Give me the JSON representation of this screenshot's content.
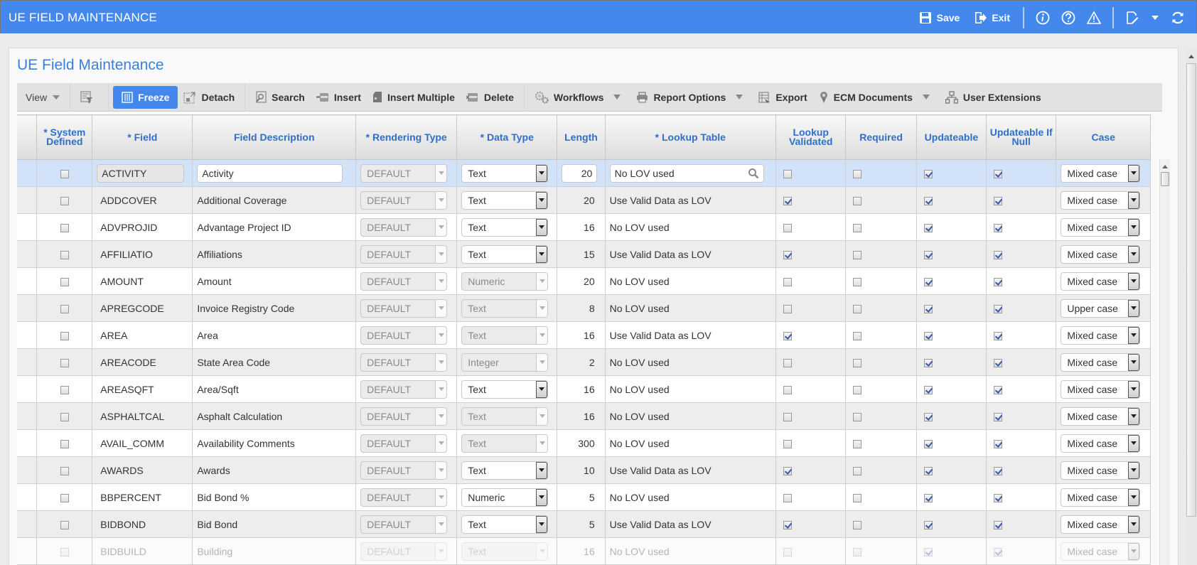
{
  "app": {
    "title": "UE FIELD MAINTENANCE",
    "actions": {
      "save": "Save",
      "exit": "Exit"
    },
    "icons": [
      "save-icon",
      "exit-icon",
      "info-icon",
      "help-icon",
      "warning-icon",
      "edit-note-icon",
      "dropdown-caret-icon",
      "refresh-icon"
    ]
  },
  "page": {
    "title": "UE Field Maintenance"
  },
  "toolbar": {
    "view": "View",
    "freeze": "Freeze",
    "detach": "Detach",
    "search": "Search",
    "insert": "Insert",
    "insert_multiple": "Insert Multiple",
    "delete": "Delete",
    "workflows": "Workflows",
    "report_options": "Report Options",
    "export": "Export",
    "ecm_documents": "ECM Documents",
    "user_extensions": "User Extensions"
  },
  "grid": {
    "columns": {
      "system_defined": "* System Defined",
      "field": "* Field",
      "field_description": "Field Description",
      "rendering_type": "* Rendering Type",
      "data_type": "* Data Type",
      "length": "Length",
      "lookup_table": "* Lookup Table",
      "lookup_validated": "Lookup Validated",
      "required": "Required",
      "updateable": "Updateable",
      "updateable_if_null": "Updateable If Null",
      "case": "Case"
    },
    "rows": [
      {
        "system_defined": false,
        "field": "ACTIVITY",
        "description": "Activity",
        "rendering_type": "DEFAULT",
        "data_type": "Text",
        "data_type_enabled": true,
        "length": "20",
        "lookup_table": "No LOV used",
        "lookup_validated": false,
        "required": false,
        "updateable": true,
        "updateable_if_null": true,
        "case": "Mixed case",
        "selected": true
      },
      {
        "system_defined": false,
        "field": "ADDCOVER",
        "description": "Additional Coverage",
        "rendering_type": "DEFAULT",
        "data_type": "Text",
        "data_type_enabled": true,
        "length": "20",
        "lookup_table": "Use Valid Data as LOV",
        "lookup_validated": true,
        "required": false,
        "updateable": true,
        "updateable_if_null": true,
        "case": "Mixed case"
      },
      {
        "system_defined": false,
        "field": "ADVPROJID",
        "description": "Advantage Project ID",
        "rendering_type": "DEFAULT",
        "data_type": "Text",
        "data_type_enabled": true,
        "length": "16",
        "lookup_table": "No LOV used",
        "lookup_validated": false,
        "required": false,
        "updateable": true,
        "updateable_if_null": true,
        "case": "Mixed case"
      },
      {
        "system_defined": false,
        "field": "AFFILIATIO",
        "description": "Affiliations",
        "rendering_type": "DEFAULT",
        "data_type": "Text",
        "data_type_enabled": true,
        "length": "15",
        "lookup_table": "Use Valid Data as LOV",
        "lookup_validated": true,
        "required": false,
        "updateable": true,
        "updateable_if_null": true,
        "case": "Mixed case"
      },
      {
        "system_defined": false,
        "field": "AMOUNT",
        "description": "Amount",
        "rendering_type": "DEFAULT",
        "data_type": "Numeric",
        "data_type_enabled": false,
        "length": "20",
        "lookup_table": "No LOV used",
        "lookup_validated": false,
        "required": false,
        "updateable": true,
        "updateable_if_null": true,
        "case": "Mixed case"
      },
      {
        "system_defined": false,
        "field": "APREGCODE",
        "description": "Invoice Registry Code",
        "rendering_type": "DEFAULT",
        "data_type": "Text",
        "data_type_enabled": false,
        "length": "8",
        "lookup_table": "No LOV used",
        "lookup_validated": false,
        "required": false,
        "updateable": true,
        "updateable_if_null": true,
        "case": "Upper case"
      },
      {
        "system_defined": false,
        "field": "AREA",
        "description": "Area",
        "rendering_type": "DEFAULT",
        "data_type": "Text",
        "data_type_enabled": false,
        "length": "16",
        "lookup_table": "Use Valid Data as LOV",
        "lookup_validated": true,
        "required": false,
        "updateable": true,
        "updateable_if_null": true,
        "case": "Mixed case"
      },
      {
        "system_defined": false,
        "field": "AREACODE",
        "description": "State Area Code",
        "rendering_type": "DEFAULT",
        "data_type": "Integer",
        "data_type_enabled": false,
        "length": "2",
        "lookup_table": "No LOV used",
        "lookup_validated": false,
        "required": false,
        "updateable": true,
        "updateable_if_null": true,
        "case": "Mixed case"
      },
      {
        "system_defined": false,
        "field": "AREASQFT",
        "description": "Area/Sqft",
        "rendering_type": "DEFAULT",
        "data_type": "Text",
        "data_type_enabled": true,
        "length": "16",
        "lookup_table": "No LOV used",
        "lookup_validated": false,
        "required": false,
        "updateable": true,
        "updateable_if_null": true,
        "case": "Mixed case"
      },
      {
        "system_defined": false,
        "field": "ASPHALTCAL",
        "description": "Asphalt Calculation",
        "rendering_type": "DEFAULT",
        "data_type": "Text",
        "data_type_enabled": false,
        "length": "16",
        "lookup_table": "No LOV used",
        "lookup_validated": false,
        "required": false,
        "updateable": true,
        "updateable_if_null": true,
        "case": "Mixed case"
      },
      {
        "system_defined": false,
        "field": "AVAIL_COMM",
        "description": "Availability Comments",
        "rendering_type": "DEFAULT",
        "data_type": "Text",
        "data_type_enabled": false,
        "length": "300",
        "lookup_table": "No LOV used",
        "lookup_validated": false,
        "required": false,
        "updateable": true,
        "updateable_if_null": true,
        "case": "Mixed case"
      },
      {
        "system_defined": false,
        "field": "AWARDS",
        "description": "Awards",
        "rendering_type": "DEFAULT",
        "data_type": "Text",
        "data_type_enabled": true,
        "length": "10",
        "lookup_table": "Use Valid Data as LOV",
        "lookup_validated": true,
        "required": false,
        "updateable": true,
        "updateable_if_null": true,
        "case": "Mixed case"
      },
      {
        "system_defined": false,
        "field": "BBPERCENT",
        "description": "Bid Bond %",
        "rendering_type": "DEFAULT",
        "data_type": "Numeric",
        "data_type_enabled": true,
        "length": "5",
        "lookup_table": "No LOV used",
        "lookup_validated": false,
        "required": false,
        "updateable": true,
        "updateable_if_null": true,
        "case": "Mixed case"
      },
      {
        "system_defined": false,
        "field": "BIDBOND",
        "description": "Bid Bond",
        "rendering_type": "DEFAULT",
        "data_type": "Text",
        "data_type_enabled": true,
        "length": "5",
        "lookup_table": "Use Valid Data as LOV",
        "lookup_validated": true,
        "required": false,
        "updateable": true,
        "updateable_if_null": true,
        "case": "Mixed case"
      },
      {
        "system_defined": false,
        "field": "BIDBUILD",
        "description": "Building",
        "rendering_type": "DEFAULT",
        "data_type": "Text",
        "data_type_enabled": false,
        "length": "16",
        "lookup_table": "No LOV used",
        "lookup_validated": false,
        "required": false,
        "updateable": true,
        "updateable_if_null": true,
        "case": "Mixed case",
        "faded": true
      }
    ]
  }
}
